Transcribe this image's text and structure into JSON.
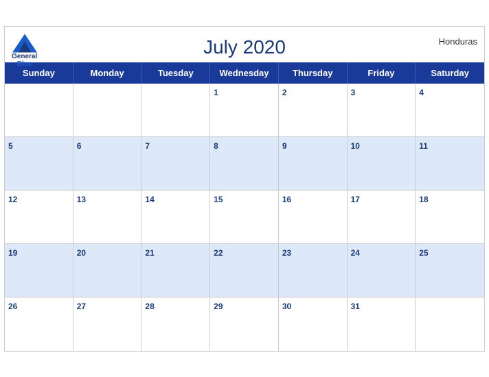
{
  "header": {
    "title": "July 2020",
    "country": "Honduras",
    "logo": {
      "general": "General",
      "blue": "Blue"
    }
  },
  "days": [
    "Sunday",
    "Monday",
    "Tuesday",
    "Wednesday",
    "Thursday",
    "Friday",
    "Saturday"
  ],
  "weeks": [
    [
      "",
      "",
      "",
      "1",
      "2",
      "3",
      "4"
    ],
    [
      "5",
      "6",
      "7",
      "8",
      "9",
      "10",
      "11"
    ],
    [
      "12",
      "13",
      "14",
      "15",
      "16",
      "17",
      "18"
    ],
    [
      "19",
      "20",
      "21",
      "22",
      "23",
      "24",
      "25"
    ],
    [
      "26",
      "27",
      "28",
      "29",
      "30",
      "31",
      ""
    ]
  ]
}
